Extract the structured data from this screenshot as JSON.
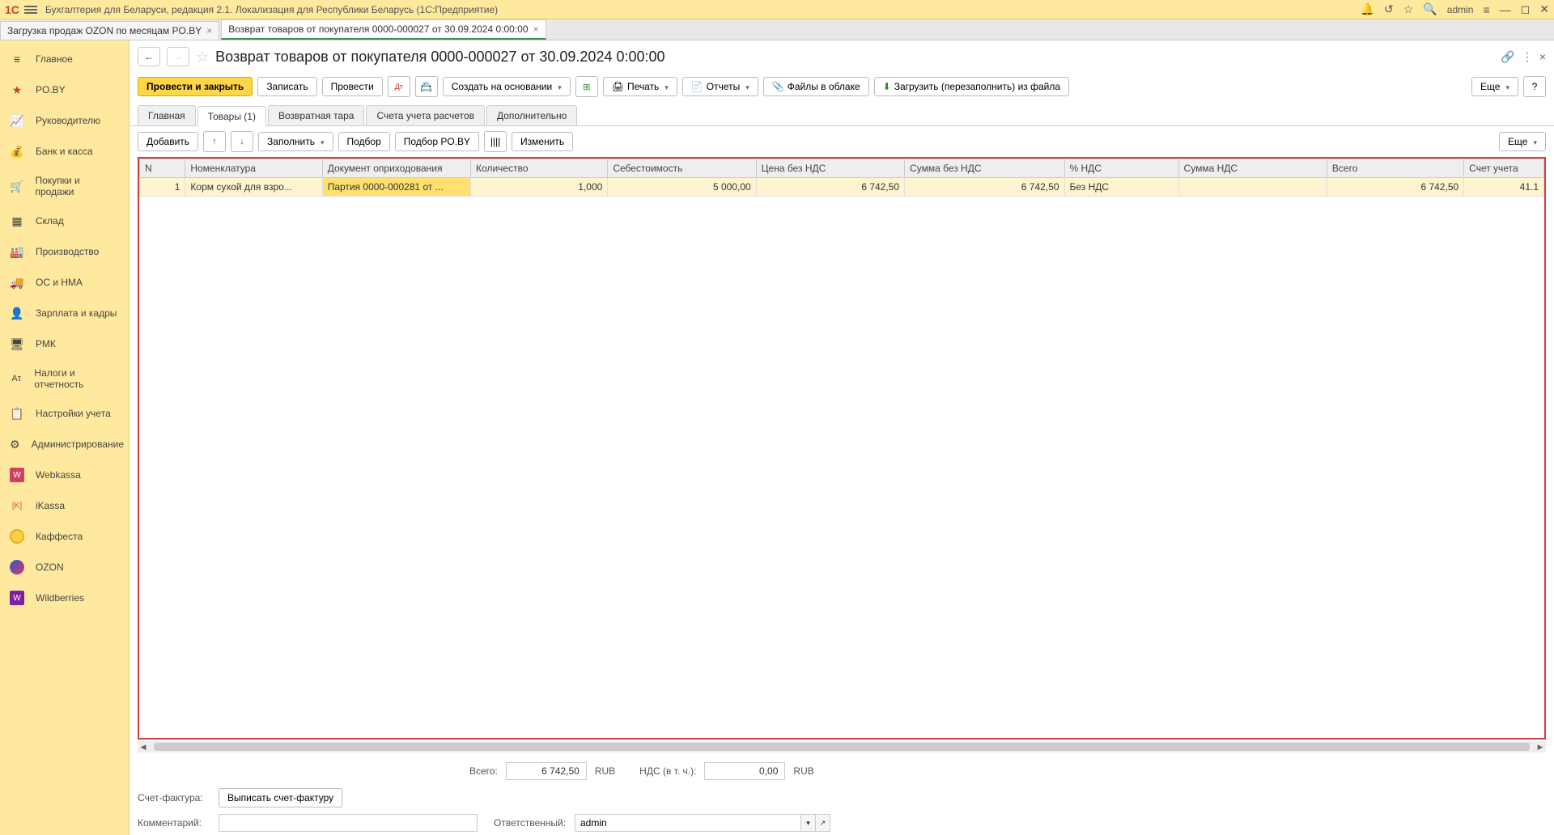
{
  "titlebar": {
    "logo": "1С",
    "title": "Бухгалтерия для Беларуси, редакция 2.1. Локализация для Республики Беларусь  (1С:Предприятие)",
    "user": "admin"
  },
  "tabs": [
    {
      "label": "Загрузка продаж OZON по месяцам PO.BY"
    },
    {
      "label": "Возврат товаров от покупателя 0000-000027 от 30.09.2024 0:00:00"
    }
  ],
  "sidebar": [
    {
      "label": "Главное",
      "icon": "≡"
    },
    {
      "label": "PO.BY",
      "icon": "★"
    },
    {
      "label": "Руководителю",
      "icon": "📈"
    },
    {
      "label": "Банк и касса",
      "icon": "💰"
    },
    {
      "label": "Покупки и продажи",
      "icon": "🛒"
    },
    {
      "label": "Склад",
      "icon": "▦"
    },
    {
      "label": "Производство",
      "icon": "🏭"
    },
    {
      "label": "ОС и НМА",
      "icon": "🚚"
    },
    {
      "label": "Зарплата и кадры",
      "icon": "👤"
    },
    {
      "label": "РМК",
      "icon": "🖥"
    },
    {
      "label": "Налоги и отчетность",
      "icon": "Аτ"
    },
    {
      "label": "Настройки учета",
      "icon": "📋"
    },
    {
      "label": "Администрирование",
      "icon": "⚙"
    },
    {
      "label": "Webkassa",
      "icon": "W",
      "color": "#d04060"
    },
    {
      "label": "iKassa",
      "icon": "[K]",
      "color": "#e05030"
    },
    {
      "label": "Каффеста",
      "icon": "●",
      "color": "#ffd040"
    },
    {
      "label": "OZON",
      "icon": "◐",
      "color": "#2060d0"
    },
    {
      "label": "Wildberries",
      "icon": "W",
      "color": "#8020a0"
    }
  ],
  "heading": "Возврат товаров от покупателя 0000-000027 от 30.09.2024 0:00:00",
  "toolbar": {
    "primary": "Провести и закрыть",
    "record": "Записать",
    "post": "Провести",
    "create_based": "Создать на основании",
    "print": "Печать",
    "reports": "Отчеты",
    "cloud": "Файлы в облаке",
    "load": "Загрузить (перезаполнить) из файла",
    "more": "Еще"
  },
  "subtabs": [
    "Главная",
    "Товары (1)",
    "Возвратная тара",
    "Счета учета расчетов",
    "Дополнительно"
  ],
  "subtoolbar": {
    "add": "Добавить",
    "fill": "Заполнить",
    "pick": "Подбор",
    "pick_poby": "Подбор PO.BY",
    "edit": "Изменить",
    "more": "Еще"
  },
  "columns": [
    "N",
    "Номенклатура",
    "Документ оприходования",
    "Количество",
    "Себестоимость",
    "Цена без НДС",
    "Сумма без НДС",
    "% НДС",
    "Сумма НДС",
    "Всего",
    "Счет учета"
  ],
  "row": {
    "n": "1",
    "nomen": "Корм сухой для взро...",
    "doc": "Партия 0000-000281 от ...",
    "qty": "1,000",
    "cost": "5 000,00",
    "price": "6 742,50",
    "sum": "6 742,50",
    "vat_pct": "Без НДС",
    "vat_sum": "",
    "total": "6 742,50",
    "account": "41.1"
  },
  "totals": {
    "total_lbl": "Всего:",
    "total_val": "6 742,50",
    "total_cur": "RUB",
    "vat_lbl": "НДС (в т. ч.):",
    "vat_val": "0,00",
    "vat_cur": "RUB"
  },
  "invoice": {
    "lbl": "Счет-фактура:",
    "btn": "Выписать счет-фактуру"
  },
  "footer": {
    "comment_lbl": "Комментарий:",
    "comment_val": "",
    "resp_lbl": "Ответственный:",
    "resp_val": "admin"
  }
}
